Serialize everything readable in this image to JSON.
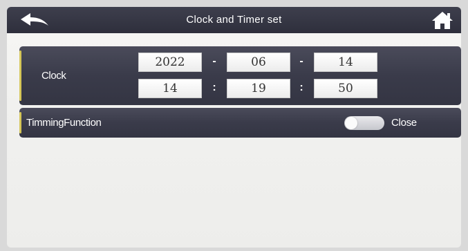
{
  "header": {
    "title": "Clock and Timer set"
  },
  "clock": {
    "label": "Clock",
    "date": {
      "year": "2022",
      "month": "06",
      "day": "14",
      "separator": "-"
    },
    "time": {
      "hour": "14",
      "minute": "19",
      "second": "50",
      "separator": ":"
    }
  },
  "timing": {
    "label": "TimmingFunction",
    "state": "Close",
    "enabled": false
  },
  "colors": {
    "header_bg": "#2e2f3c",
    "panel_bg": "#3a3b4a",
    "accent": "#d6c75a",
    "screen_bg": "#f1f1ef"
  },
  "icons": {
    "back": "back-arrow-icon",
    "home": "home-icon"
  }
}
